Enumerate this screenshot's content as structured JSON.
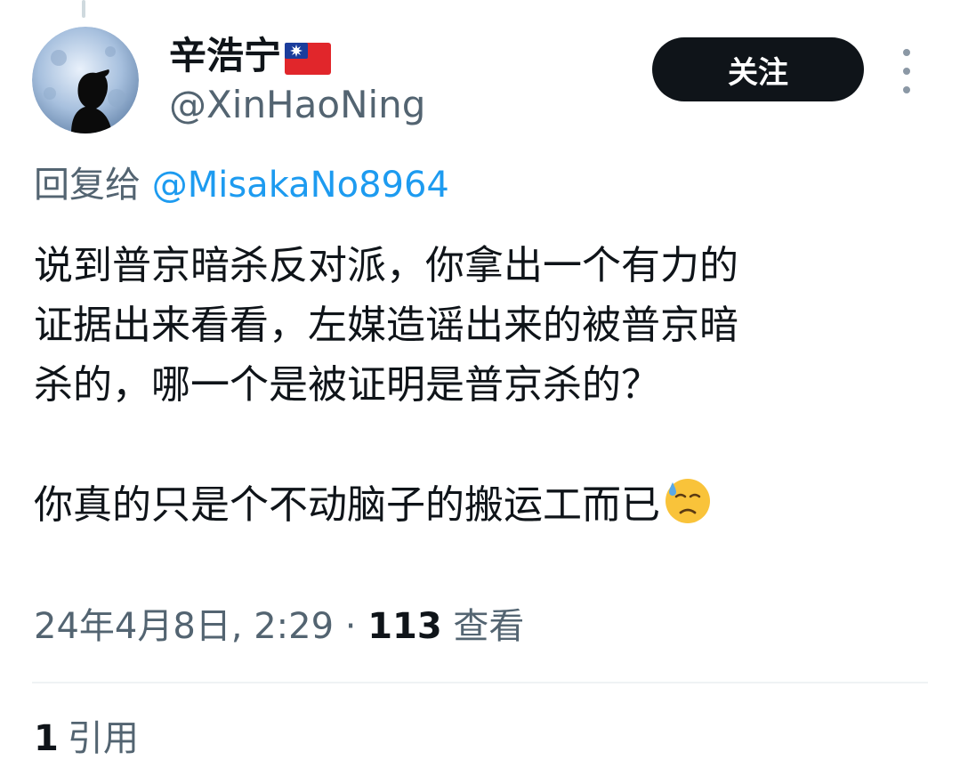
{
  "header": {
    "display_name": "辛浩宁",
    "flag_icon": "taiwan-flag-icon",
    "handle": "@XinHaoNing",
    "follow_label": "关注",
    "more_icon": "more-vertical-icon"
  },
  "reply": {
    "prefix": "回复给",
    "mention": "@MisakaNo8964"
  },
  "tweet": {
    "line1": "说到普京暗杀反对派，你拿出一个有力的",
    "line2": "证据出来看看，左媒造谣出来的被普京暗",
    "line3": "杀的，哪一个是被证明是普京杀的？",
    "line4": "你真的只是个不动脑子的搬运工而已",
    "emoji": "downcast-face-with-sweat-emoji"
  },
  "meta": {
    "datetime": "24年4月8日, 2:29",
    "separator": " · ",
    "views_count": "113",
    "views_label": " 查看"
  },
  "engagement": {
    "quotes_count": "1",
    "quotes_label": "引用"
  },
  "colors": {
    "primary_text": "#0f1419",
    "secondary_text": "#536471",
    "link": "#1d9bf0",
    "follow_bg": "#0f1419"
  }
}
